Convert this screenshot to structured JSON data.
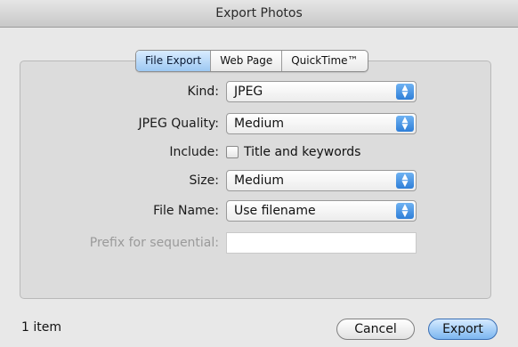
{
  "window": {
    "title": "Export Photos"
  },
  "tabs": [
    {
      "label": "File Export",
      "active": true
    },
    {
      "label": "Web Page",
      "active": false
    },
    {
      "label": "QuickTime™",
      "active": false
    }
  ],
  "form": {
    "kind": {
      "label": "Kind:",
      "value": "JPEG"
    },
    "jpeg_quality": {
      "label": "JPEG Quality:",
      "value": "Medium"
    },
    "include": {
      "label": "Include:",
      "checkbox_label": "Title and keywords",
      "checked": false
    },
    "size": {
      "label": "Size:",
      "value": "Medium"
    },
    "file_name": {
      "label": "File Name:",
      "value": "Use filename"
    },
    "prefix": {
      "label": "Prefix for sequential:",
      "value": "",
      "disabled": true
    }
  },
  "footer": {
    "item_count": "1 item",
    "cancel_label": "Cancel",
    "export_label": "Export"
  },
  "colors": {
    "accent": "#3a8ee6",
    "window_bg": "#e8e8e8"
  },
  "icons": {
    "popup_arrows": "up-down-arrows-icon"
  }
}
